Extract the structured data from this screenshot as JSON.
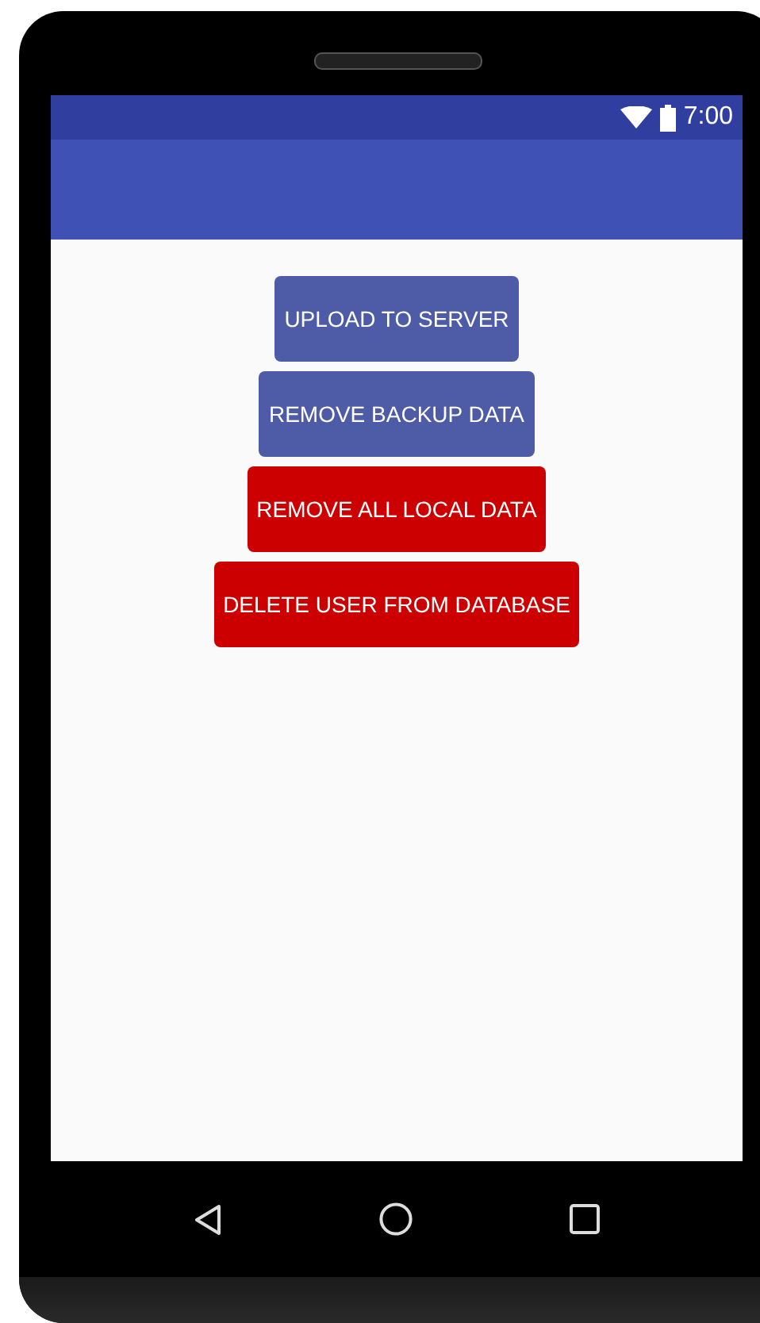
{
  "status_bar": {
    "time": "7:00"
  },
  "buttons": [
    {
      "label": "UPLOAD TO SERVER",
      "kind": "primary"
    },
    {
      "label": "REMOVE BACKUP DATA",
      "kind": "primary"
    },
    {
      "label": "REMOVE ALL LOCAL DATA",
      "kind": "danger"
    },
    {
      "label": "DELETE USER FROM DATABASE",
      "kind": "danger"
    }
  ]
}
